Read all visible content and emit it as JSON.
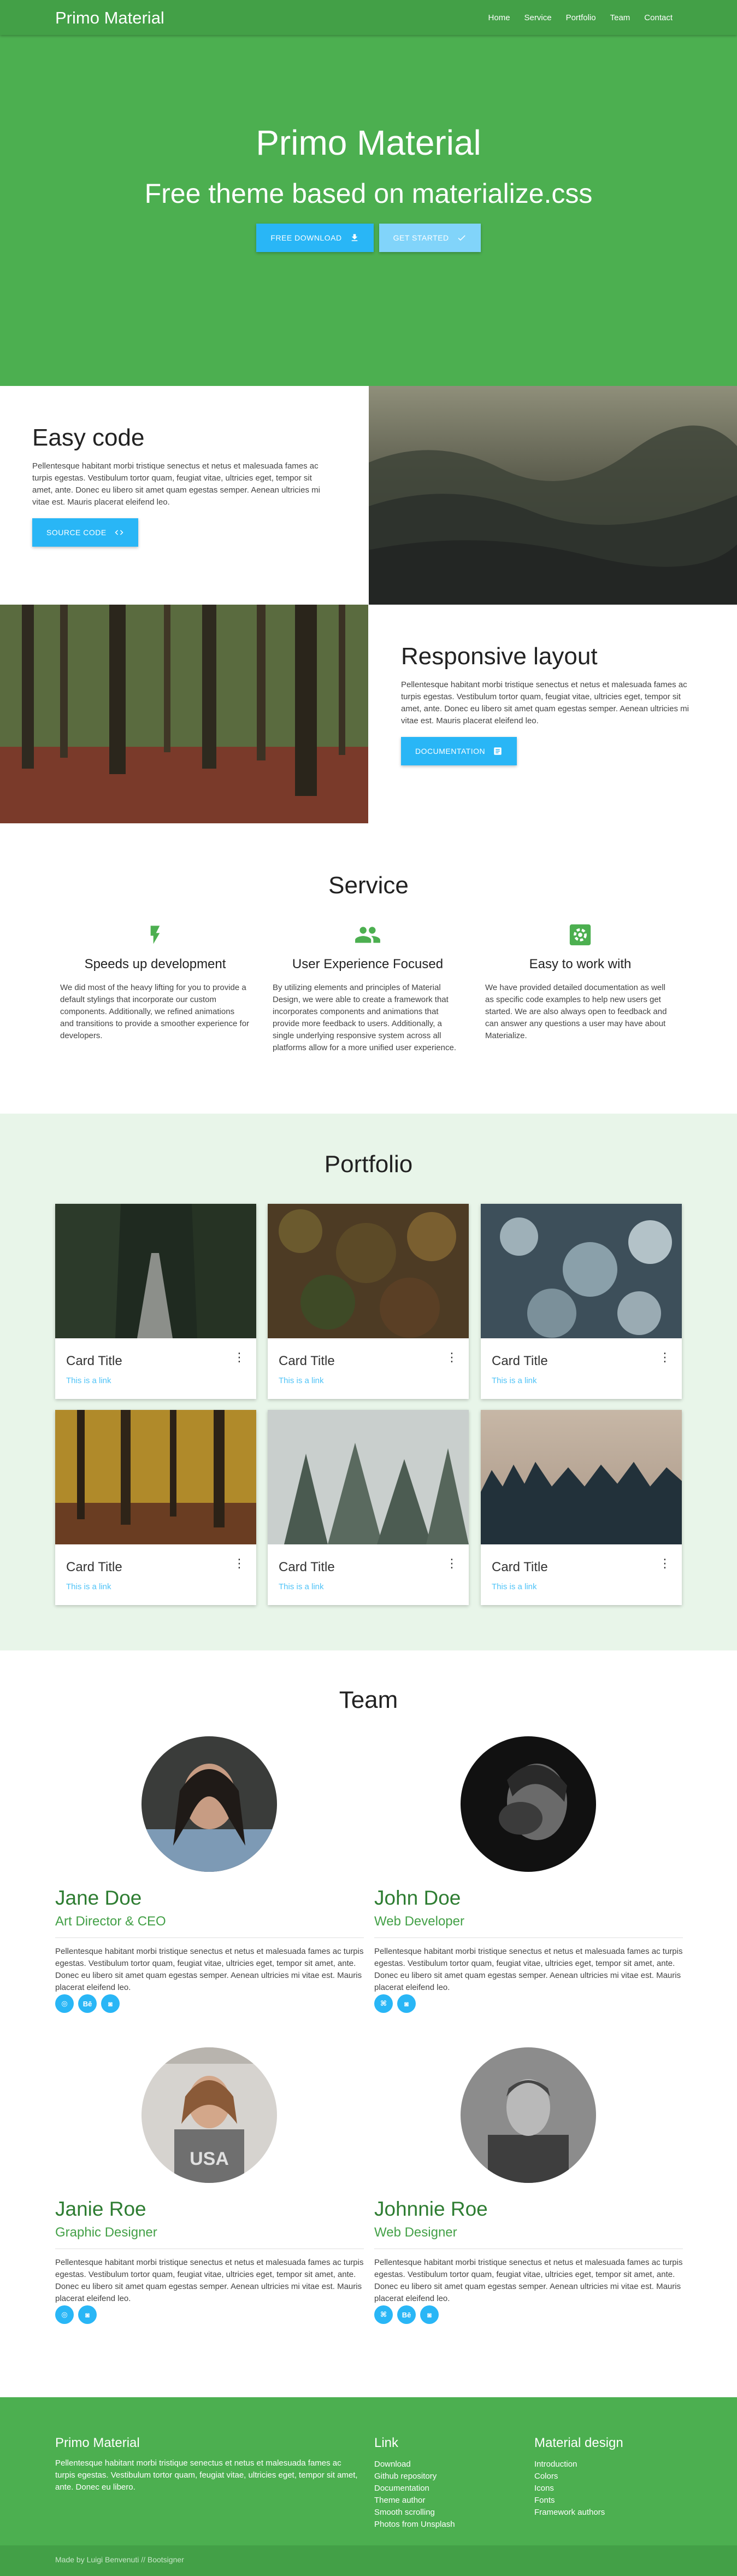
{
  "nav": {
    "brand": "Primo Material",
    "links": [
      "Home",
      "Service",
      "Portfolio",
      "Team",
      "Contact"
    ]
  },
  "hero": {
    "title": "Primo Material",
    "subtitle": "Free theme based on materialize.css",
    "download_label": "Free Download",
    "start_label": "Get Started"
  },
  "features": [
    {
      "title": "Easy code",
      "text": "Pellentesque habitant morbi tristique senectus et netus et malesuada fames ac turpis egestas. Vestibulum tortor quam, feugiat vitae, ultricies eget, tempor sit amet, ante. Donec eu libero sit amet quam egestas semper. Aenean ultricies mi vitae est. Mauris placerat eleifend leo.",
      "button": "Source Code"
    },
    {
      "title": "Responsive layout",
      "text": "Pellentesque habitant morbi tristique senectus et netus et malesuada fames ac turpis egestas. Vestibulum tortor quam, feugiat vitae, ultricies eget, tempor sit amet, ante. Donec eu libero sit amet quam egestas semper. Aenean ultricies mi vitae est. Mauris placerat eleifend leo.",
      "button": "Documentation"
    }
  ],
  "service": {
    "title": "Service",
    "items": [
      {
        "icon": "flash-icon",
        "title": "Speeds up development",
        "text": "We did most of the heavy lifting for you to provide a default stylings that incorporate our custom components. Additionally, we refined animations and transitions to provide a smoother experience for developers."
      },
      {
        "icon": "group-icon",
        "title": "User Experience Focused",
        "text": "By utilizing elements and principles of Material Design, we were able to create a framework that incorporates components and animations that provide more feedback to users. Additionally, a single underlying responsive system across all platforms allow for a more unified user experience."
      },
      {
        "icon": "settings-icon",
        "title": "Easy to work with",
        "text": "We have provided detailed documentation as well as specific code examples to help new users get started. We are also always open to feedback and can answer any questions a user may have about Materialize."
      }
    ]
  },
  "portfolio": {
    "title": "Portfolio",
    "cards": [
      {
        "title": "Card Title",
        "link": "This is a link"
      },
      {
        "title": "Card Title",
        "link": "This is a link"
      },
      {
        "title": "Card Title",
        "link": "This is a link"
      },
      {
        "title": "Card Title",
        "link": "This is a link"
      },
      {
        "title": "Card Title",
        "link": "This is a link"
      },
      {
        "title": "Card Title",
        "link": "This is a link"
      }
    ]
  },
  "team": {
    "title": "Team",
    "members": [
      {
        "name": "Jane Doe",
        "role": "Art Director & CEO",
        "bio": "Pellentesque habitant morbi tristique senectus et netus et malesuada fames ac turpis egestas. Vestibulum tortor quam, feugiat vitae, ultricies eget, tempor sit amet, ante. Donec eu libero sit amet quam egestas semper. Aenean ultricies mi vitae est. Mauris placerat eleifend leo.",
        "socials": [
          "dribbble-icon",
          "behance-icon",
          "instagram-icon"
        ]
      },
      {
        "name": "John Doe",
        "role": "Web Developer",
        "bio": "Pellentesque habitant morbi tristique senectus et netus et malesuada fames ac turpis egestas. Vestibulum tortor quam, feugiat vitae, ultricies eget, tempor sit amet, ante. Donec eu libero sit amet quam egestas semper. Aenean ultricies mi vitae est. Mauris placerat eleifend leo.",
        "socials": [
          "github-icon",
          "instagram-icon"
        ]
      },
      {
        "name": "Janie Roe",
        "role": "Graphic Designer",
        "bio": "Pellentesque habitant morbi tristique senectus et netus et malesuada fames ac turpis egestas. Vestibulum tortor quam, feugiat vitae, ultricies eget, tempor sit amet, ante. Donec eu libero sit amet quam egestas semper. Aenean ultricies mi vitae est. Mauris placerat eleifend leo.",
        "socials": [
          "dribbble-icon",
          "instagram-icon"
        ]
      },
      {
        "name": "Johnnie Roe",
        "role": "Web Designer",
        "bio": "Pellentesque habitant morbi tristique senectus et netus et malesuada fames ac turpis egestas. Vestibulum tortor quam, feugiat vitae, ultricies eget, tempor sit amet, ante. Donec eu libero sit amet quam egestas semper. Aenean ultricies mi vitae est. Mauris placerat eleifend leo.",
        "socials": [
          "github-icon",
          "behance-icon",
          "instagram-icon"
        ]
      }
    ]
  },
  "footer": {
    "brand": "Primo Material",
    "text": "Pellentesque habitant morbi tristique senectus et netus et malesuada fames ac turpis egestas. Vestibulum tortor quam, feugiat vitae, ultricies eget, tempor sit amet, ante. Donec eu libero.",
    "link_title": "Link",
    "links": [
      "Download",
      "Github repository",
      "Documentation",
      "Theme author",
      "Smooth scrolling",
      "Photos from Unsplash"
    ],
    "md_title": "Material design",
    "md_links": [
      "Introduction",
      "Colors",
      "Icons",
      "Fonts",
      "Framework authors"
    ],
    "credit": "Made by Luigi Benvenuti // Bootsigner"
  },
  "colors": {
    "primary": "#4caf50",
    "primary_dark": "#43a047",
    "accent": "#29b6f6",
    "portfolio_bg": "#e8f5e9"
  }
}
